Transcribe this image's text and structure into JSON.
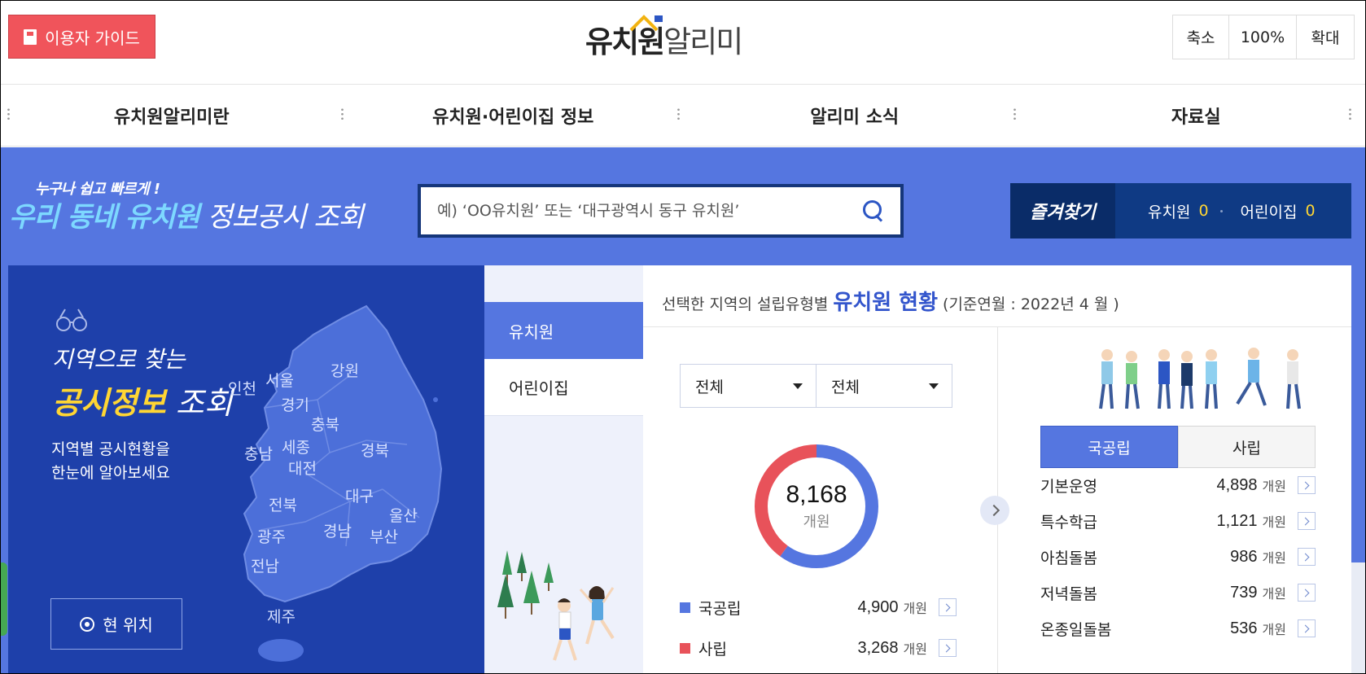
{
  "header": {
    "guide_label": "이용자 가이드",
    "logo_bold": "유치원",
    "logo_light": "알리미",
    "zoom_out": "축소",
    "zoom_level": "100%",
    "zoom_in": "확대"
  },
  "nav": {
    "items": [
      "유치원알리미란",
      "유치원·어린이집 정보",
      "알리미 소식",
      "자료실"
    ]
  },
  "banner": {
    "slogan_top": "누구나 쉽고 빠르게 !",
    "slogan_prefix": "우리 동네 ",
    "slogan_highlight": "유치원",
    "slogan_suffix": " 정보공시 조회",
    "search_placeholder": "예) ‘OO유치원’ 또는 ‘대구광역시 동구 유치원’"
  },
  "favorites": {
    "label": "즐겨찾기",
    "kindergarten_label": "유치원",
    "kindergarten_count": "0",
    "daycare_label": "어린이집",
    "daycare_count": "0"
  },
  "region": {
    "title_line1": "지역으로 찾는",
    "title_highlight": "공시정보",
    "title_suffix": " 조회",
    "desc_line1": "지역별 공시현황을",
    "desc_line2": "한눈에 알아보세요",
    "current_location": "현 위치",
    "regions": {
      "incheon": "인천",
      "seoul": "서울",
      "gangwon": "강원",
      "gyeonggi": "경기",
      "chungbuk": "충북",
      "chungnam": "충남",
      "sejong": "세종",
      "daejeon": "대전",
      "gyeongbuk": "경북",
      "daegu": "대구",
      "jeonbuk": "전북",
      "ulsan": "울산",
      "gyeongnam": "경남",
      "busan": "부산",
      "gwangju": "광주",
      "jeonnam": "전남",
      "jeju": "제주"
    }
  },
  "tabs": {
    "kindergarten": "유치원",
    "daycare": "어린이집"
  },
  "stats": {
    "title_prefix": "선택한 지역의 설립유형별",
    "title_main": "유치원 현황",
    "title_date": "(기준연월 : 2022년 4 월 )",
    "select1": "전체",
    "select2": "전체",
    "total": "8,168",
    "total_unit": "개원",
    "public_label": "국공립",
    "public_value": "4,900",
    "private_label": "사립",
    "private_value": "3,268",
    "unit": "개원",
    "colors": {
      "public": "#5576e0",
      "private": "#e8525a"
    }
  },
  "chart_data": {
    "type": "pie",
    "categories": [
      "국공립",
      "사립"
    ],
    "values": [
      4900,
      3268
    ],
    "colors": [
      "#5576e0",
      "#e8525a"
    ]
  },
  "detail": {
    "tab_public": "국공립",
    "tab_private": "사립",
    "unit": "개원",
    "rows": [
      {
        "label": "기본운영",
        "value": "4,898"
      },
      {
        "label": "특수학급",
        "value": "1,121"
      },
      {
        "label": "아침돌봄",
        "value": "986"
      },
      {
        "label": "저녁돌봄",
        "value": "739"
      },
      {
        "label": "온종일돌봄",
        "value": "536"
      }
    ]
  }
}
